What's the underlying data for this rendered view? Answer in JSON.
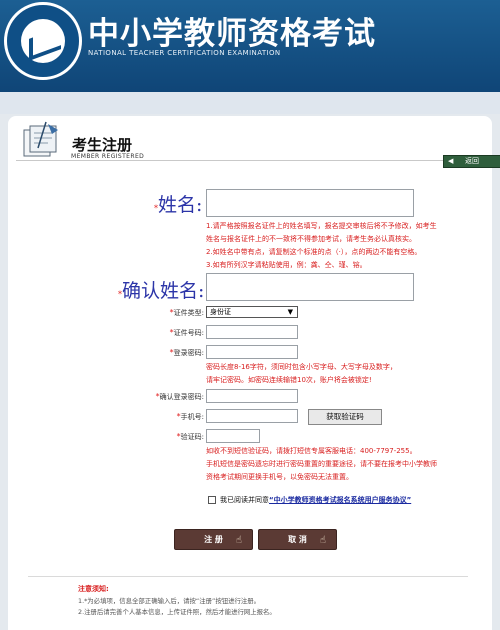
{
  "header": {
    "site_title": "中小学教师资格考试",
    "site_subtitle": "NATIONAL TEACHER CERTIFICATION EXAMINATION",
    "logo_ring_text": "National Teacher Certification Examination"
  },
  "card": {
    "title": "考生注册",
    "subtitle": "MEMBER REGISTERED",
    "back_label": "返回"
  },
  "form": {
    "name_label": "姓名:",
    "name_notes": [
      "1.请严格按照报名证件上的姓名填写，报名提交审核后将不予修改，如考生",
      "姓名与报名证件上的不一致将不得参加考试，请考生务必认真核实。",
      "2.如姓名中带有点，请复制这个标准的点（·），点的两边不能有空格。",
      "3.如有所列汉字请粘贴使用，例：龚、仝、瑾、镕。"
    ],
    "confirm_name_label": "确认姓名:",
    "id_type_label": "证件类型:",
    "id_type_value": "身份证",
    "id_number_label": "证件号码:",
    "password_label": "登录密码:",
    "password_notes": [
      "密码长度8-16字符，须同时包含小写字母、大写字母及数字，",
      "请牢记密码。如密码连续输错10次，账户将会被锁定!"
    ],
    "confirm_password_label": "确认登录密码:",
    "phone_label": "手机号:",
    "get_code_label": "获取验证码",
    "code_label": "验证码:",
    "code_notes": [
      "如收不到短信验证码，请拨打短信专属客服电话：400-7797-255。",
      "手机短信是密码遗忘时进行密码重置的重要途径，请不要在报考中小学教师",
      "资格考试期间更换手机号，以免密码无法重置。"
    ],
    "required_mark": "*",
    "agree_prefix": "我已阅读并同意",
    "agree_link": "“中小学教师资格考试报名系统用户服务协议”"
  },
  "actions": {
    "register_label": "注 册",
    "cancel_label": "取 消"
  },
  "footer": {
    "title": "注意须知:",
    "items": [
      "1.*为必填项，信息全部正确输入后，请按“注册”按钮进行注册。",
      "2.注册后请完善个人基本信息，上传证件照，然后才能进行网上报名。"
    ]
  }
}
